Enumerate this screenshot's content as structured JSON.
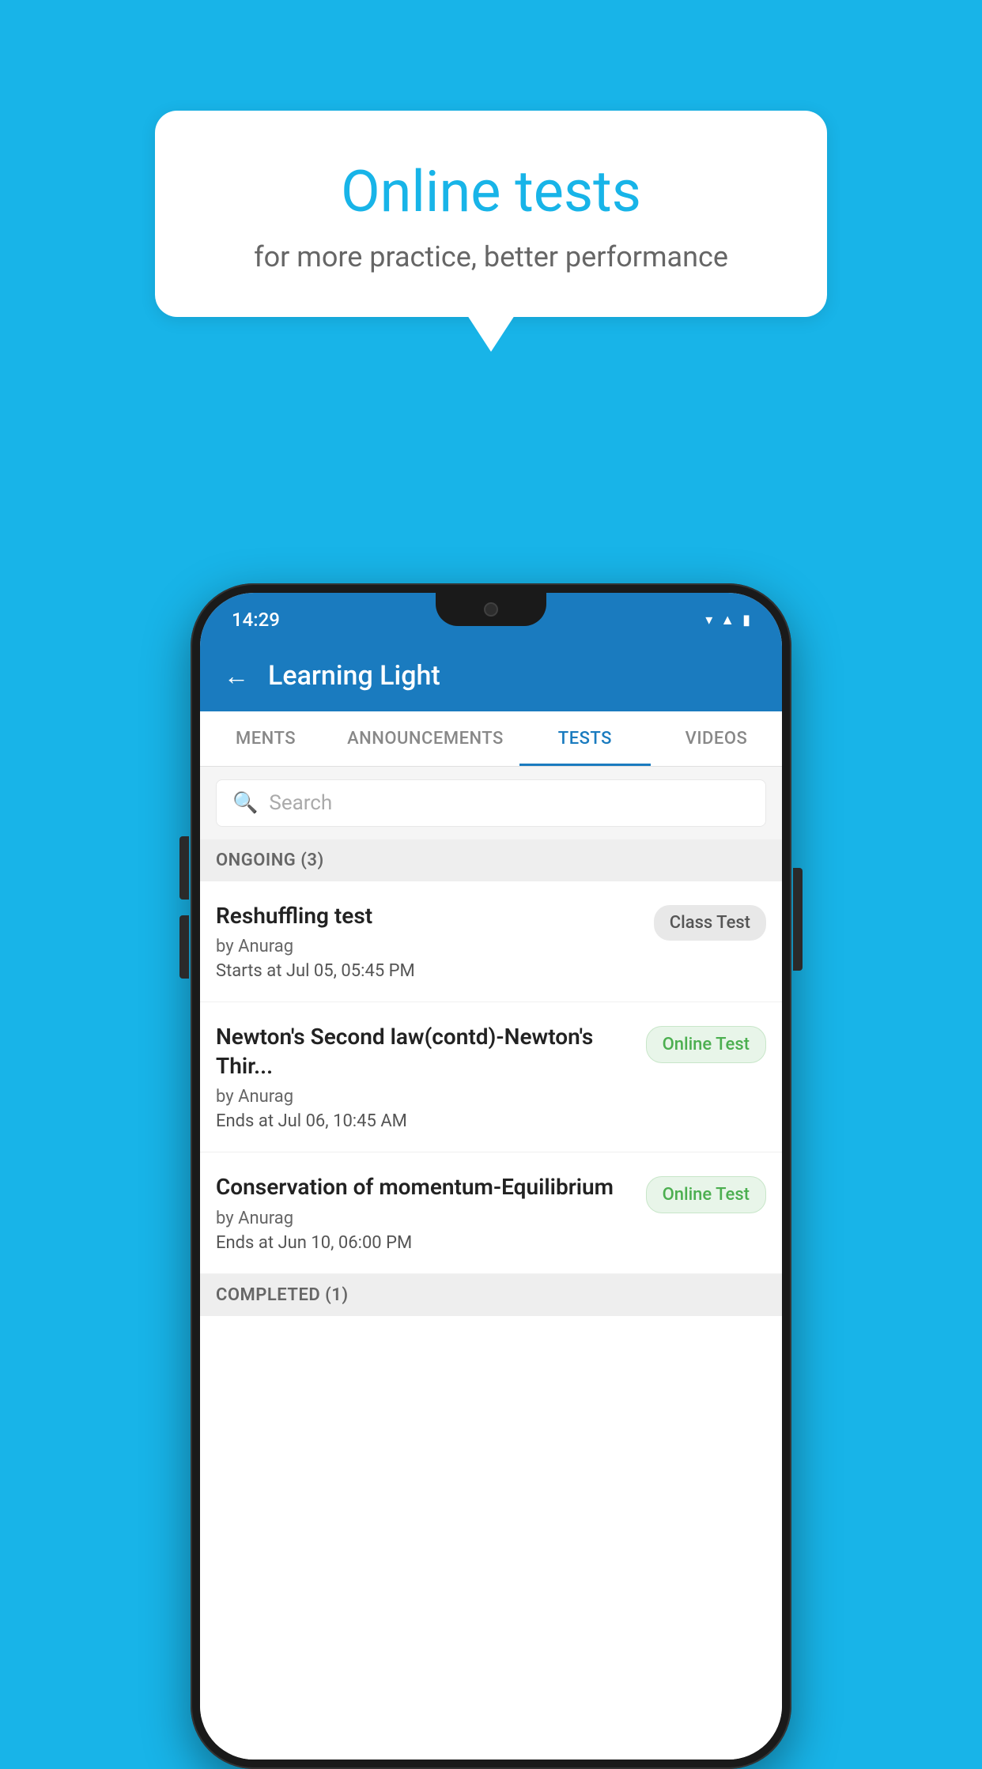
{
  "background_color": "#18b4e8",
  "bubble": {
    "title": "Online tests",
    "subtitle": "for more practice, better performance"
  },
  "phone": {
    "status_bar": {
      "time": "14:29",
      "icons": [
        "wifi",
        "signal",
        "battery"
      ]
    },
    "header": {
      "title": "Learning Light",
      "back_label": "←"
    },
    "tabs": [
      {
        "label": "MENTS",
        "active": false
      },
      {
        "label": "ANNOUNCEMENTS",
        "active": false
      },
      {
        "label": "TESTS",
        "active": true
      },
      {
        "label": "VIDEOS",
        "active": false
      }
    ],
    "search": {
      "placeholder": "Search"
    },
    "section_ongoing": "ONGOING (3)",
    "tests": [
      {
        "name": "Reshuffling test",
        "by": "by Anurag",
        "time": "Starts at  Jul 05, 05:45 PM",
        "badge": "Class Test",
        "badge_type": "class"
      },
      {
        "name": "Newton's Second law(contd)-Newton's Thir...",
        "by": "by Anurag",
        "time": "Ends at  Jul 06, 10:45 AM",
        "badge": "Online Test",
        "badge_type": "online"
      },
      {
        "name": "Conservation of momentum-Equilibrium",
        "by": "by Anurag",
        "time": "Ends at  Jun 10, 06:00 PM",
        "badge": "Online Test",
        "badge_type": "online"
      }
    ],
    "section_completed": "COMPLETED (1)"
  }
}
